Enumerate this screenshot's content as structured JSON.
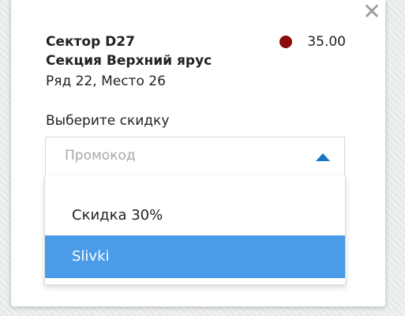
{
  "popup": {
    "close_glyph": "✕",
    "sector": "Сектор D27",
    "section": "Секция Верхний ярус",
    "row_seat": "Ряд 22, Место 26",
    "price": "35.00",
    "price_color": "#8b0a0a",
    "discount_label": "Выберите скидку",
    "select": {
      "placeholder": "Промокод",
      "accent_color": "#1b74c4"
    },
    "options": [
      {
        "label": "Скидка 30%",
        "highlighted": false
      },
      {
        "label": "Slivki",
        "highlighted": true
      }
    ],
    "highlight_color": "#4a9be8"
  }
}
